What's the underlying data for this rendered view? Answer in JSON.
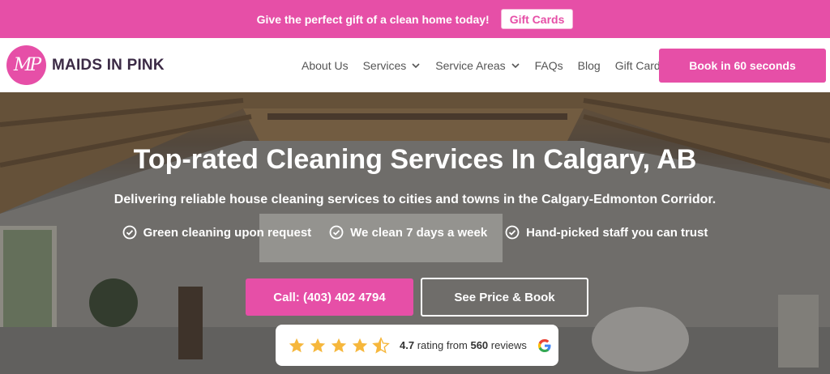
{
  "promo": {
    "text": "Give the perfect gift of a clean home today!",
    "button": "Gift Cards"
  },
  "header": {
    "logo_monogram": "MP",
    "logo_name": "MAIDS IN PINK",
    "nav": [
      {
        "label": "About Us",
        "dropdown": false
      },
      {
        "label": "Services",
        "dropdown": true
      },
      {
        "label": "Service Areas",
        "dropdown": true
      },
      {
        "label": "FAQs",
        "dropdown": false
      },
      {
        "label": "Blog",
        "dropdown": false
      },
      {
        "label": "Gift Cards",
        "dropdown": false
      }
    ],
    "cta": "Book in 60 seconds"
  },
  "hero": {
    "title": "Top-rated Cleaning Services In Calgary, AB",
    "subtitle": "Delivering reliable house cleaning services to cities and towns in the Calgary-Edmonton Corridor.",
    "features": [
      "Green cleaning upon request",
      "We clean 7 days a week",
      "Hand-picked staff you can trust"
    ],
    "call_button": "Call: (403) 402 4794",
    "price_button": "See Price & Book"
  },
  "rating": {
    "score": "4.7",
    "middle": "rating from",
    "count": "560",
    "suffix": "reviews",
    "stars_value": 4.5
  },
  "colors": {
    "brand_pink": "#e64fa7",
    "star_gold": "#f6b73c"
  },
  "icons": [
    "chevron-down-icon",
    "check-circle-icon",
    "star-icon",
    "half-star-icon",
    "google-icon"
  ]
}
